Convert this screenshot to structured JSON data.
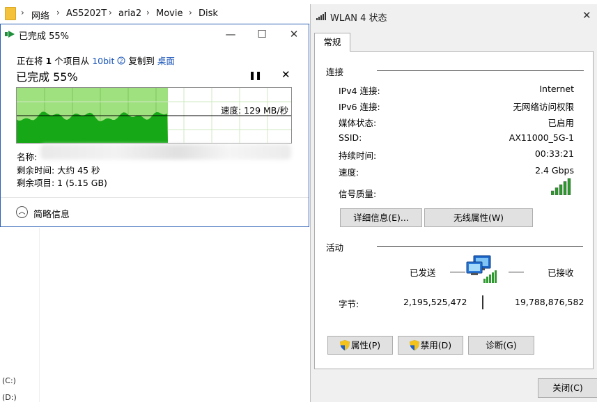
{
  "explorer": {
    "breadcrumb": [
      "网络",
      "AS5202T",
      "aria2",
      "Movie",
      "Disk"
    ],
    "drives": [
      "(C:)",
      "(D:)"
    ]
  },
  "copy_dialog": {
    "title": "已完成 55%",
    "info_prefix": "正在将",
    "info_count": "1",
    "info_mid": "个项目从",
    "info_source": "10bit",
    "info_to": "复制到",
    "info_dest": "桌面",
    "big_status": "已完成 55%",
    "speed": "速度: 129 MB/秒",
    "progress_fraction": 0.55,
    "name_label": "名称:",
    "name_value_partial": "...][...].Olymp...",
    "time_left": "剩余时间: 大约 45 秒",
    "items_left": "剩余项目: 1 (5.15 GB)",
    "details_toggle": "简略信息",
    "colors": {
      "progress_fill": "#9fe07f",
      "speed_area": "#16a816",
      "accent": "#2b5fb4"
    }
  },
  "wlan_dialog": {
    "title": "WLAN 4 状态",
    "tab": "常规",
    "connection_label": "连接",
    "rows": [
      {
        "label": "IPv4 连接:",
        "value": "Internet"
      },
      {
        "label": "IPv6 连接:",
        "value": "无网络访问权限"
      },
      {
        "label": "媒体状态:",
        "value": "已启用"
      },
      {
        "label": "SSID:",
        "value": "AX11000_5G-1"
      },
      {
        "label": "持续时间:",
        "value": "00:33:21"
      },
      {
        "label": "速度:",
        "value": "2.4 Gbps"
      }
    ],
    "signal_label": "信号质量:",
    "signal_level": 5,
    "details_button": "详细信息(E)...",
    "wireless_props_button": "无线属性(W)",
    "activity_label": "活动",
    "sent_label": "已发送",
    "received_label": "已接收",
    "bytes_label": "字节:",
    "bytes_sent": "2,195,525,472",
    "bytes_received": "19,788,876,582",
    "properties_button": "属性(P)",
    "disable_button": "禁用(D)",
    "diagnose_button": "诊断(G)",
    "close_button": "关闭(C)"
  }
}
